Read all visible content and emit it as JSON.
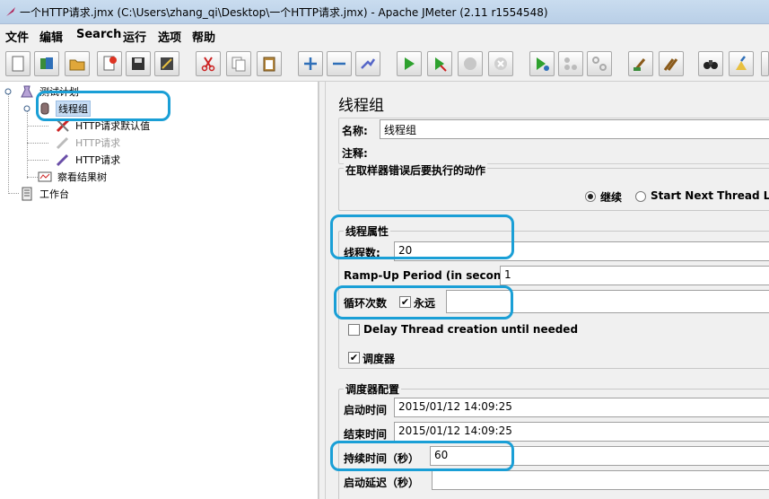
{
  "window": {
    "title": "一个HTTP请求.jmx (C:\\Users\\zhang_qi\\Desktop\\一个HTTP请求.jmx) - Apache JMeter (2.11 r1554548)"
  },
  "menu": [
    "文件",
    "编辑",
    "Search",
    "运行",
    "选项",
    "帮助"
  ],
  "toolbar": {
    "buttons": [
      "new-icon",
      "templates-icon",
      "open-icon",
      "close-icon",
      "save-icon",
      "save-as-icon",
      "cut-icon",
      "copy-icon",
      "paste-icon",
      "expand-icon",
      "collapse-icon",
      "toggle-icon",
      "start-icon",
      "start-no-pause-icon",
      "stop-icon",
      "shutdown-icon",
      "remote-start-icon",
      "remote-stop-icon",
      "remote-shutdown-icon",
      "clear-icon",
      "clear-all-icon",
      "search-icon",
      "reset-search-icon"
    ]
  },
  "tree": {
    "items": [
      {
        "label": "测试计划",
        "icon": "test-plan-icon"
      },
      {
        "label": "线程组",
        "icon": "thread-group-icon"
      },
      {
        "label": "HTTP请求默认值",
        "icon": "http-defaults-icon"
      },
      {
        "label": "HTTP请求",
        "icon": "http-sampler-icon"
      },
      {
        "label": "HTTP请求",
        "icon": "http-sampler-icon"
      },
      {
        "label": "察看结果树",
        "icon": "result-tree-icon"
      },
      {
        "label": "工作台",
        "icon": "workbench-icon"
      }
    ]
  },
  "panel": {
    "title": "线程组",
    "name_label": "名称:",
    "name_value": "线程组",
    "comment_label": "注释:",
    "error_action_legend": "在取样器错误后要执行的动作",
    "error_options": [
      "继续",
      "Start Next Thread Loop"
    ],
    "error_selected": "继续",
    "thread_props_legend": "线程属性",
    "threads_label": "线程数:",
    "threads_value": "20",
    "rampup_label": "Ramp-Up Period (in seconds):",
    "rampup_value": "1",
    "loop_label": "循环次数",
    "forever_label": "永远",
    "forever_checked": true,
    "delay_label": "Delay Thread creation until needed",
    "delay_checked": false,
    "scheduler_label": "调度器",
    "scheduler_checked": true,
    "scheduler_config_legend": "调度器配置",
    "start_time_label": "启动时间",
    "start_time_value": "2015/01/12 14:09:25",
    "end_time_label": "结束时间",
    "end_time_value": "2015/01/12 14:09:25",
    "duration_label": "持续时间（秒）",
    "duration_value": "60",
    "startup_delay_label": "启动延迟（秒）",
    "startup_delay_value": ""
  },
  "colors": {
    "annotation": "#1a9fd6",
    "selection": "#c6dcf4"
  }
}
